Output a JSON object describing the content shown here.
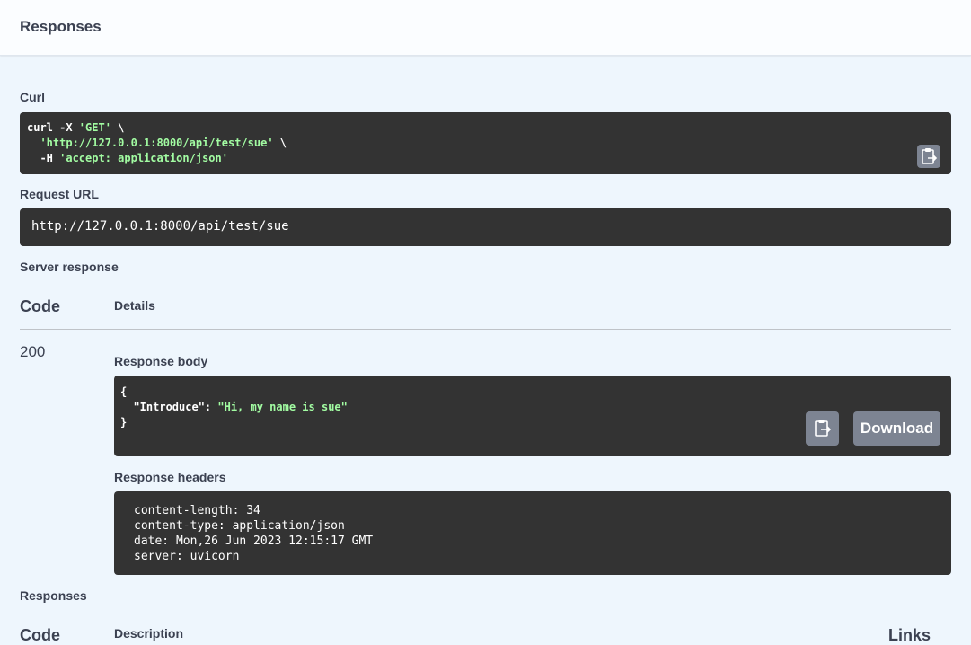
{
  "header": {
    "title": "Responses"
  },
  "curl": {
    "label": "Curl",
    "line1_cmd": "curl -X ",
    "line1_method": "'GET'",
    "line1_tail": " \\",
    "line2_indent": "  ",
    "line2_url": "'http://127.0.0.1:8000/api/test/sue'",
    "line2_tail": " \\",
    "line3_flag": "  -H ",
    "line3_header": "'accept: application/json'"
  },
  "request_url": {
    "label": "Request URL",
    "value": "http://127.0.0.1:8000/api/test/sue"
  },
  "server_response": {
    "label": "Server response",
    "code_header": "Code",
    "details_header": "Details",
    "status_code": "200",
    "body_label": "Response body",
    "body_open": "{",
    "body_key": "  \"Introduce\": ",
    "body_value": "\"Hi, my name is sue\"",
    "body_close": "}",
    "download_label": "Download",
    "headers_label": "Response headers",
    "headers": [
      "content-length: 34",
      "content-type: application/json",
      "date: Mon,26 Jun 2023 12:15:17 GMT",
      "server: uvicorn"
    ]
  },
  "responses": {
    "label": "Responses",
    "code_header": "Code",
    "description_header": "Description",
    "links_header": "Links"
  },
  "icons": {
    "copy": "clipboard-copy-icon"
  },
  "colors": {
    "page_bg": "#eef6fd",
    "code_bg": "#333333",
    "code_string": "#a2fca2",
    "button_bg": "#7d8492"
  }
}
